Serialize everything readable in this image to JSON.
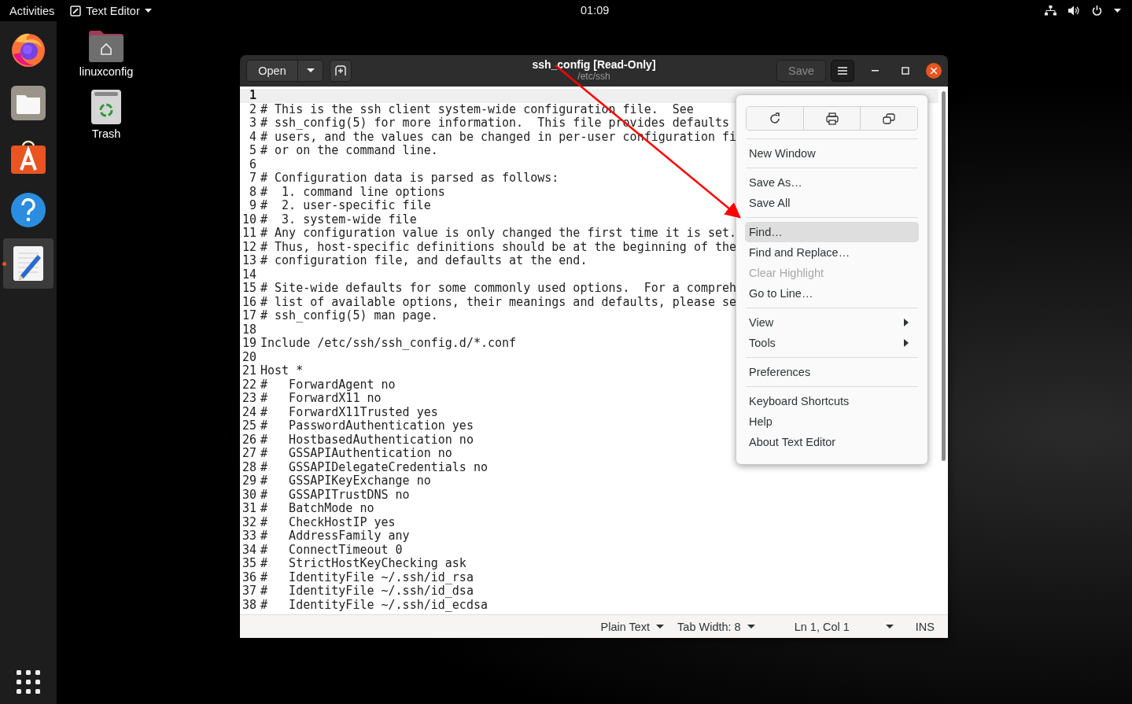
{
  "top_bar": {
    "activities": "Activities",
    "app_menu": "Text Editor",
    "clock": "01:09"
  },
  "dock": {
    "items": [
      {
        "kind": "firefox",
        "selected": false
      },
      {
        "kind": "files",
        "selected": false
      },
      {
        "kind": "software",
        "selected": false
      },
      {
        "kind": "help",
        "selected": false
      },
      {
        "kind": "text-editor",
        "selected": true
      }
    ]
  },
  "desktop_icons": [
    {
      "kind": "home-folder",
      "label": "linuxconfig"
    },
    {
      "kind": "trash",
      "label": "Trash"
    }
  ],
  "window": {
    "open_button": "Open",
    "title": "ssh_config [Read-Only]",
    "subtitle": "/etc/ssh",
    "save_button": {
      "label": "Save",
      "disabled": true
    },
    "menu_button": {
      "pressed": true
    }
  },
  "editor": {
    "lines": [
      {
        "number": "1",
        "current": true
      },
      {
        "number": "2",
        "text": "# This is the ssh client system-wide configuration file.  See",
        "current": false
      },
      {
        "number": "3",
        "text": "# ssh_config(5) for more information.  This file provides defaults",
        "current": false
      },
      {
        "number": "4",
        "text": "# users, and the values can be changed in per-user configuration fi",
        "current": false
      },
      {
        "number": "5",
        "text": "# or on the command line.",
        "current": false
      },
      {
        "number": "6",
        "current": false
      },
      {
        "number": "7",
        "text": "# Configuration data is parsed as follows:",
        "current": false
      },
      {
        "number": "8",
        "text": "#  1. command line options",
        "current": false
      },
      {
        "number": "9",
        "text": "#  2. user-specific file",
        "current": false
      },
      {
        "number": "10",
        "text": "#  3. system-wide file",
        "current": false
      },
      {
        "number": "11",
        "text": "# Any configuration value is only changed the first time it is set.",
        "current": false
      },
      {
        "number": "12",
        "text": "# Thus, host-specific definitions should be at the beginning of the",
        "current": false
      },
      {
        "number": "13",
        "text": "# configuration file, and defaults at the end.",
        "current": false
      },
      {
        "number": "14",
        "current": false
      },
      {
        "number": "15",
        "text": "# Site-wide defaults for some commonly used options.  For a compreh",
        "current": false
      },
      {
        "number": "16",
        "text": "# list of available options, their meanings and defaults, please se",
        "current": false
      },
      {
        "number": "17",
        "text": "# ssh_config(5) man page.",
        "current": false
      },
      {
        "number": "18",
        "current": false
      },
      {
        "number": "19",
        "text": "Include /etc/ssh/ssh_config.d/*.conf",
        "current": false
      },
      {
        "number": "20",
        "current": false
      },
      {
        "number": "21",
        "text": "Host *",
        "current": false
      },
      {
        "number": "22",
        "text": "#   ForwardAgent no",
        "current": false
      },
      {
        "number": "23",
        "text": "#   ForwardX11 no",
        "current": false
      },
      {
        "number": "24",
        "text": "#   ForwardX11Trusted yes",
        "current": false
      },
      {
        "number": "25",
        "text": "#   PasswordAuthentication yes",
        "current": false
      },
      {
        "number": "26",
        "text": "#   HostbasedAuthentication no",
        "current": false
      },
      {
        "number": "27",
        "text": "#   GSSAPIAuthentication no",
        "current": false
      },
      {
        "number": "28",
        "text": "#   GSSAPIDelegateCredentials no",
        "current": false
      },
      {
        "number": "29",
        "text": "#   GSSAPIKeyExchange no",
        "current": false
      },
      {
        "number": "30",
        "text": "#   GSSAPITrustDNS no",
        "current": false
      },
      {
        "number": "31",
        "text": "#   BatchMode no",
        "current": false
      },
      {
        "number": "32",
        "text": "#   CheckHostIP yes",
        "current": false
      },
      {
        "number": "33",
        "text": "#   AddressFamily any",
        "current": false
      },
      {
        "number": "34",
        "text": "#   ConnectTimeout 0",
        "current": false
      },
      {
        "number": "35",
        "text": "#   StrictHostKeyChecking ask",
        "current": false
      },
      {
        "number": "36",
        "text": "#   IdentityFile ~/.ssh/id_rsa",
        "current": false
      },
      {
        "number": "37",
        "text": "#   IdentityFile ~/.ssh/id_dsa",
        "current": false
      },
      {
        "number": "38",
        "text": "#   IdentityFile ~/.ssh/id_ecdsa",
        "current": false
      }
    ]
  },
  "menu": {
    "icon_buttons": [
      {
        "kind": "reload"
      },
      {
        "kind": "print"
      },
      {
        "kind": "new-window"
      }
    ],
    "sections": [
      [
        {
          "label": "New Window",
          "selected": false,
          "disabled": false,
          "submenu": false
        }
      ],
      [
        {
          "label": "Save As…",
          "selected": false,
          "disabled": false,
          "submenu": false
        },
        {
          "label": "Save All",
          "selected": false,
          "disabled": false,
          "submenu": false
        }
      ],
      [
        {
          "label": "Find…",
          "selected": true,
          "disabled": false,
          "submenu": false
        },
        {
          "label": "Find and Replace…",
          "selected": false,
          "disabled": false,
          "submenu": false
        },
        {
          "label": "Clear Highlight",
          "selected": false,
          "disabled": true,
          "submenu": false
        },
        {
          "label": "Go to Line…",
          "selected": false,
          "disabled": false,
          "submenu": false
        }
      ],
      [
        {
          "label": "View",
          "selected": false,
          "disabled": false,
          "submenu": true
        },
        {
          "label": "Tools",
          "selected": false,
          "disabled": false,
          "submenu": true
        }
      ],
      [
        {
          "label": "Preferences",
          "selected": false,
          "disabled": false,
          "submenu": false
        }
      ],
      [
        {
          "label": "Keyboard Shortcuts",
          "selected": false,
          "disabled": false,
          "submenu": false
        },
        {
          "label": "Help",
          "selected": false,
          "disabled": false,
          "submenu": false
        },
        {
          "label": "About Text Editor",
          "selected": false,
          "disabled": false,
          "submenu": false
        }
      ]
    ]
  },
  "status_bar": {
    "language": "Plain Text",
    "tab_width": "Tab Width: 8",
    "position": "Ln 1, Col 1",
    "mode": "INS"
  }
}
